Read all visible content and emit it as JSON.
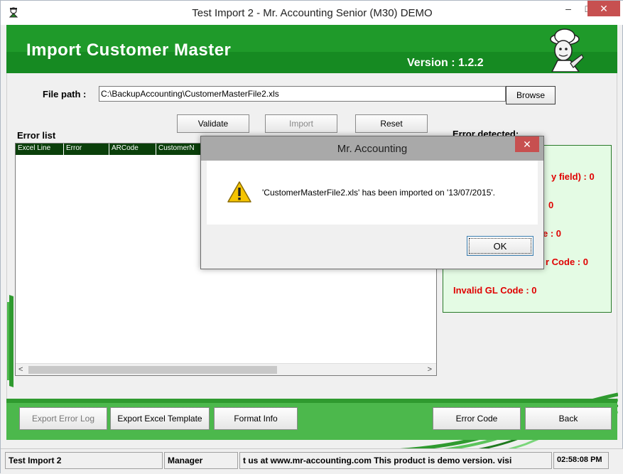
{
  "window": {
    "title": "Test Import 2 - Mr. Accounting Senior (M30) DEMO",
    "minimize": "–",
    "maximize": "□",
    "close": "✕"
  },
  "header": {
    "title": "Import Customer Master",
    "version": "Version : 1.2.2"
  },
  "form": {
    "file_label": "File path :",
    "file_value": "C:\\BackupAccounting\\CustomerMasterFile2.xls",
    "browse_label": "Browse",
    "validate_label": "Validate",
    "import_label": "Import",
    "reset_label": "Reset"
  },
  "error_list": {
    "label": "Error list",
    "columns": [
      "Excel Line",
      "Error",
      "ARCode",
      "CustomerN"
    ],
    "scroll_left": "<",
    "scroll_right": ">"
  },
  "error_detected": {
    "label": "Error detected:",
    "lines": [
      "y field) : 0",
      "0",
      "e : 0",
      "r Code : 0",
      "Invalid GL Code : 0"
    ]
  },
  "bottom": {
    "export_error_log": "Export Error Log",
    "export_excel_template": "Export Excel Template",
    "format_info": "Format Info",
    "error_code": "Error Code",
    "back": "Back"
  },
  "statusbar": {
    "company": "Test Import 2",
    "user": "Manager",
    "marquee": "t us at www.mr-accounting.com This product is demo version.  visi",
    "time": "02:58:08 PM"
  },
  "dialog": {
    "title": "Mr. Accounting",
    "close": "✕",
    "message": "'CustomerMasterFile2.xls' has been imported on '13/07/2015'.",
    "ok_label": "OK"
  },
  "colors": {
    "header_green": "#1f9a2a",
    "toolbar_green": "#4cb84c",
    "error_red": "#e00000",
    "grid_header": "#0a3f0a",
    "close_red": "#c75050"
  },
  "icons": [
    "app-icon",
    "avatar",
    "warning-icon",
    "close-icon"
  ]
}
